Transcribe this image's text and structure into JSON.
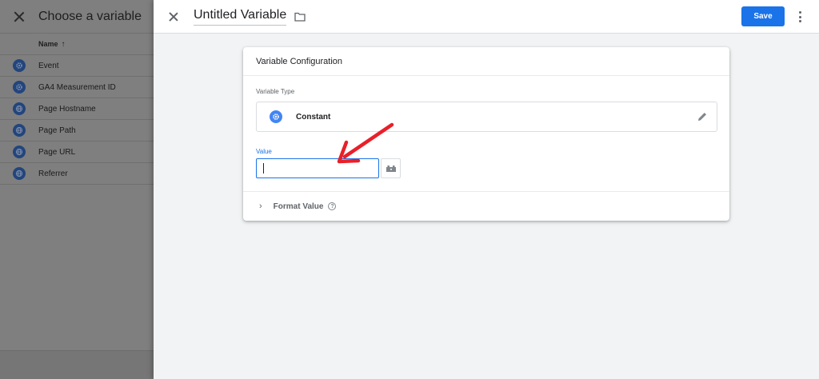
{
  "chooser": {
    "title": "Choose a variable",
    "column_header": "Name",
    "sort_icon": "arrow-up-icon",
    "items": [
      {
        "label": "Event",
        "icon": "gear-icon"
      },
      {
        "label": "GA4 Measurement ID",
        "icon": "gear-icon"
      },
      {
        "label": "Page Hostname",
        "icon": "globe-icon"
      },
      {
        "label": "Page Path",
        "icon": "globe-icon"
      },
      {
        "label": "Page URL",
        "icon": "globe-icon"
      },
      {
        "label": "Referrer",
        "icon": "globe-icon"
      }
    ]
  },
  "topbar": {
    "variable_name": "Untitled Variable",
    "save_label": "Save"
  },
  "config": {
    "title": "Variable Configuration",
    "type_label": "Variable Type",
    "type_name": "Constant",
    "value_label": "Value",
    "value": "",
    "format_label": "Format Value"
  },
  "colors": {
    "accent": "#1a73e8",
    "annotation": "#e8202a",
    "icon_blue": "#4285f4"
  }
}
